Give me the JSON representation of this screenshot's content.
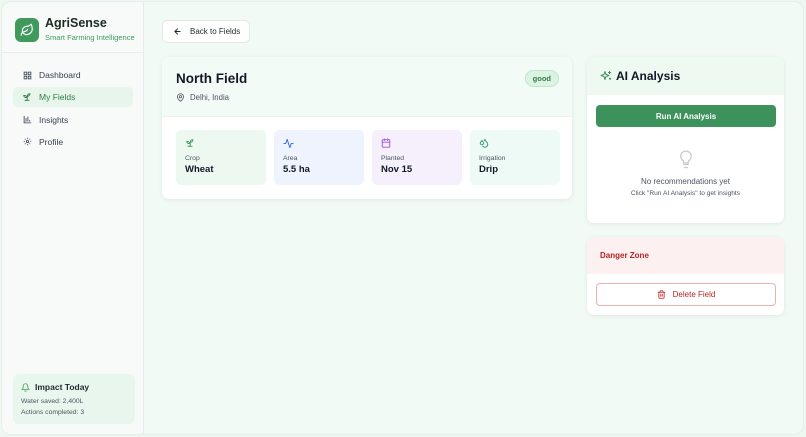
{
  "brand": {
    "name": "AgriSense",
    "tagline": "Smart Farming Intelligence",
    "icon": "leaf-icon"
  },
  "nav": {
    "items": [
      {
        "label": "Dashboard",
        "icon": "grid-icon",
        "active": false
      },
      {
        "label": "My Fields",
        "icon": "sprout-icon",
        "active": true
      },
      {
        "label": "Insights",
        "icon": "bar-chart-icon",
        "active": false
      },
      {
        "label": "Profile",
        "icon": "gear-icon",
        "active": false
      }
    ]
  },
  "impact": {
    "title": "Impact Today",
    "icon": "bell-icon",
    "water_saved": "Water saved: 2,400L",
    "actions": "Actions completed: 3"
  },
  "back_button": {
    "label": "Back to Fields",
    "icon": "arrow-left-icon"
  },
  "field": {
    "name": "North Field",
    "location": "Delhi, India",
    "status": "good",
    "stats": [
      {
        "label": "Crop",
        "value": "Wheat",
        "icon": "sprout-icon",
        "bg": "#edf8f0",
        "color": "#3f9a5c"
      },
      {
        "label": "Area",
        "value": "5.5 ha",
        "icon": "activity-icon",
        "bg": "#eef3fd",
        "color": "#3b6fd8"
      },
      {
        "label": "Planted",
        "value": "Nov 15",
        "icon": "calendar-icon",
        "bg": "#f6f0fc",
        "color": "#9b4fd6"
      },
      {
        "label": "Irrigation",
        "value": "Drip",
        "icon": "droplets-icon",
        "bg": "#eefaf5",
        "color": "#2f9a76"
      }
    ]
  },
  "ai": {
    "title": "AI Analysis",
    "icon": "sparkles-icon",
    "run_label": "Run AI Analysis",
    "empty_title": "No recommendations yet",
    "empty_subtitle": "Click \"Run AI Analysis\" to get insights",
    "empty_icon": "lightbulb-icon"
  },
  "danger": {
    "title": "Danger Zone",
    "delete_label": "Delete Field",
    "delete_icon": "trash-icon"
  },
  "colors": {
    "accent": "#3d915a",
    "danger": "#b42323",
    "background": "#f1faf4"
  }
}
